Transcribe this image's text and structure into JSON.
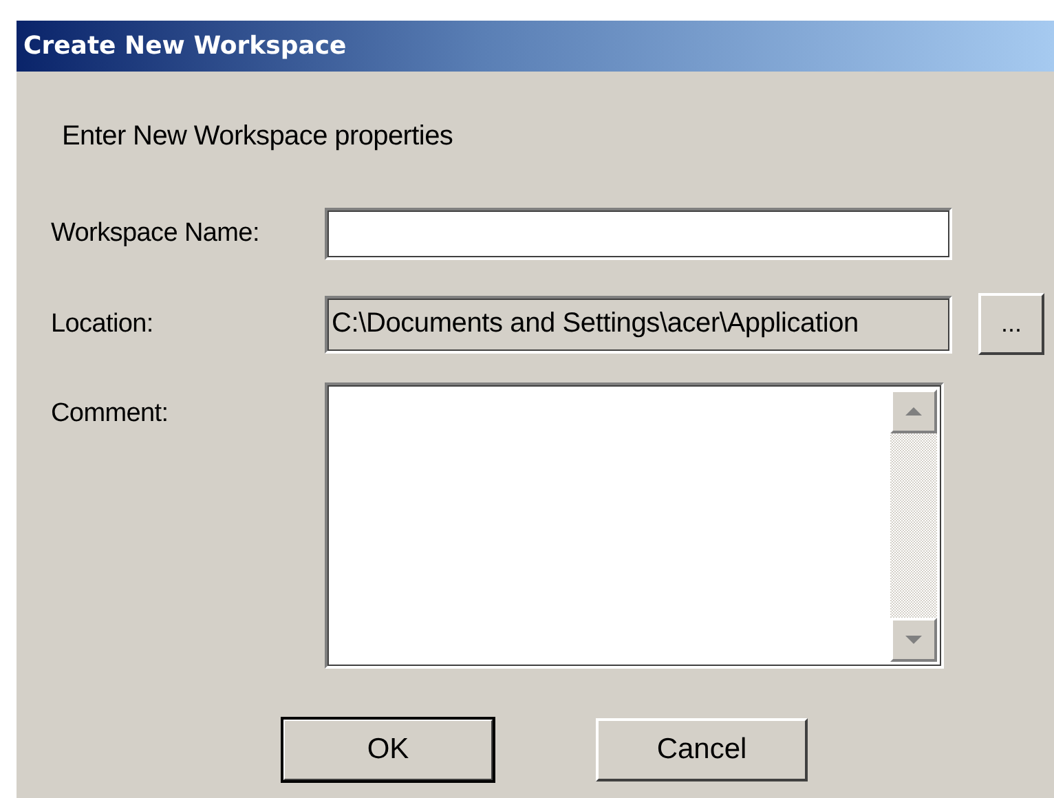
{
  "window": {
    "title": "Create New Workspace"
  },
  "intro": "Enter New Workspace properties",
  "fields": [
    {
      "kind": "text",
      "label": "Workspace Name:"
    },
    {
      "kind": "readonly",
      "label": "Location:",
      "value": "C:\\Documents and Settings\\acer\\Application",
      "browse": "..."
    },
    {
      "kind": "textarea",
      "label": "Comment:"
    }
  ],
  "buttons": [
    {
      "label": "OK",
      "default": true
    },
    {
      "label": "Cancel",
      "default": false
    }
  ]
}
